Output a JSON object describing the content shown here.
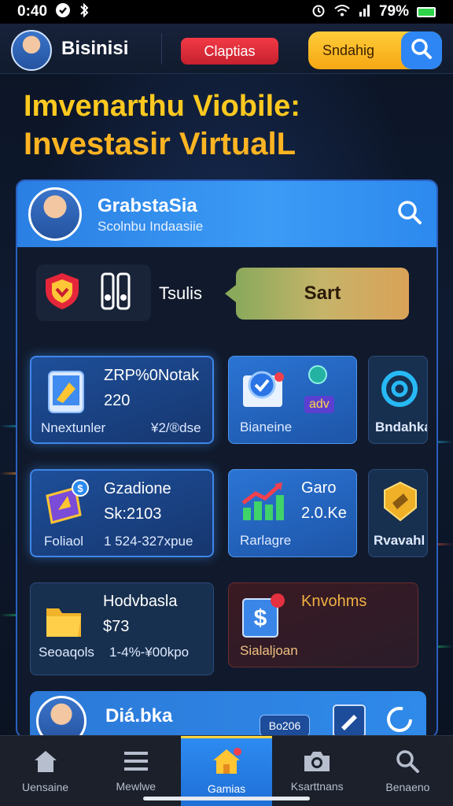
{
  "status_bar": {
    "time": "0:40",
    "battery": "79%"
  },
  "header": {
    "title": "Bisinisi",
    "pill_label": "Claptias",
    "search_label": "Sndahig"
  },
  "hero": {
    "line1": "Imvenarthu Viobile:",
    "line2": "Investasir VirtualL"
  },
  "panel": {
    "title": "GrabstaSia",
    "subtitle": "Scolnbu Indaasiie",
    "action_label": "Tsulis",
    "start_label": "Sart"
  },
  "cards": [
    {
      "title": "ZRP%0Notak",
      "value": "220",
      "bottom_left": "Nnextunler",
      "bottom_right": "¥2/®dse"
    },
    {
      "bottom_left": "Bianeine",
      "badge": "adv"
    },
    {
      "bottom_left": "Bndahka"
    },
    {
      "title": "Gzadione",
      "value": "Sk:2103",
      "bottom_left": "Foliaol",
      "bottom_right": "1 524-327xpue"
    },
    {
      "title": "Garo",
      "value": "2.0.Ke",
      "bottom_left": "Rarlagre"
    },
    {
      "bottom_left": "Rvavahl"
    },
    {
      "title": "Hodvbasla",
      "value": "$73",
      "bottom_left": "Seoaqols",
      "bottom_right": "1-4%-¥00kpo"
    },
    {
      "title": "Knvohms",
      "bottom_left": "Sialaljoan"
    }
  ],
  "bottom_card": {
    "title": "Diá.bka",
    "chip": "Bo206"
  },
  "nav": [
    {
      "label": "Uensaine",
      "icon": "home-icon"
    },
    {
      "label": "Mewlwe",
      "icon": "menu-icon"
    },
    {
      "label": "Gamias",
      "icon": "home-icon"
    },
    {
      "label": "Ksarttnans",
      "icon": "camera-icon"
    },
    {
      "label": "Benaeno",
      "icon": "search-icon"
    }
  ],
  "colors": {
    "accent_blue": "#2e86f5",
    "hero_yellow": "#ffc91f",
    "pill_red": "#f23a46",
    "search_yellow": "#ffcc3a"
  }
}
